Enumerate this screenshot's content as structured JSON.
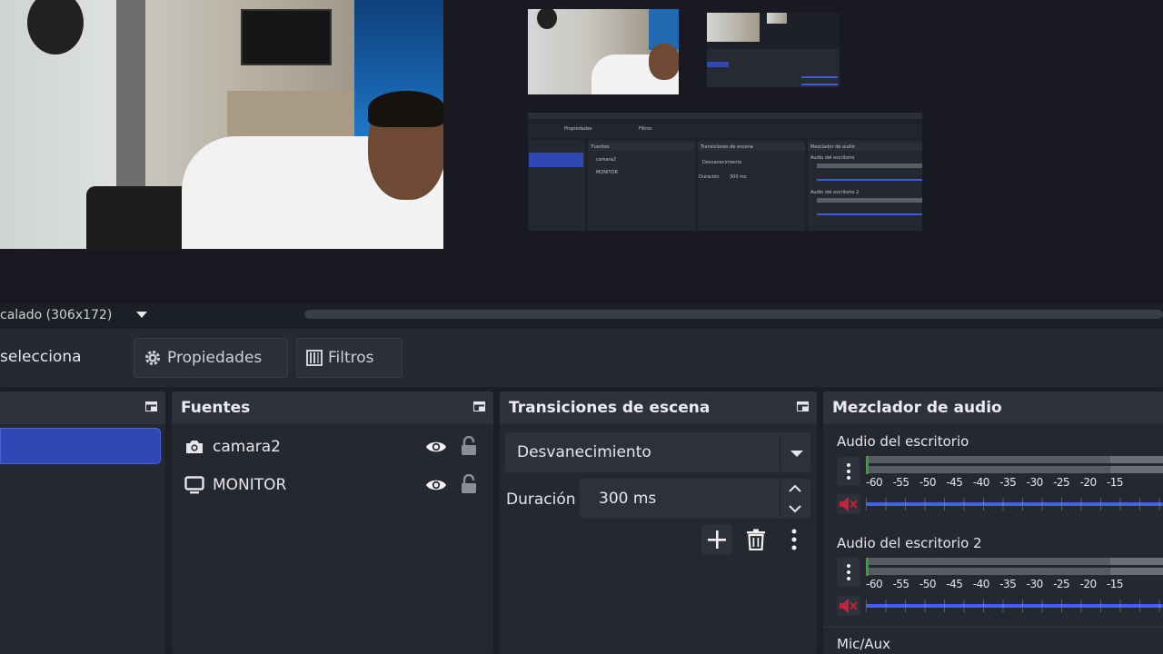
{
  "preview": {
    "minis": [
      "Desvanecimiento",
      "300 ms",
      "Fuentes",
      "camara2",
      "MONITOR",
      "Transiciones de escena",
      "Mezclador de audio",
      "Audio del escritorio",
      "Audio del escritorio 2",
      "Duración",
      "Propiedades",
      "Filtros"
    ]
  },
  "toolbar": {
    "scale_label": "calado (306x172)",
    "selected_label": "seleccionad",
    "properties_label": "Propiedades",
    "filters_label": "Filtros"
  },
  "sources": {
    "title": "Fuentes",
    "items": [
      {
        "label": "camara2",
        "icon": "camera-icon"
      },
      {
        "label": "MONITOR",
        "icon": "monitor-icon"
      }
    ]
  },
  "transitions": {
    "title": "Transiciones de escena",
    "selected": "Desvanecimiento",
    "duration_label": "Duración",
    "duration_value": "300 ms"
  },
  "mixer": {
    "title": "Mezclador de audio",
    "tracks": [
      {
        "name": "Audio del escritorio",
        "ticks": [
          "-60",
          "-55",
          "-50",
          "-45",
          "-40",
          "-35",
          "-30",
          "-25",
          "-20",
          "-15"
        ]
      },
      {
        "name": "Audio del escritorio 2",
        "ticks": [
          "-60",
          "-55",
          "-50",
          "-45",
          "-40",
          "-35",
          "-30",
          "-25",
          "-20",
          "-15"
        ]
      },
      {
        "name": "Mic/Aux"
      }
    ]
  },
  "colors": {
    "accent": "#2f48b5",
    "fader": "#4263e6",
    "muted": "#c0233a"
  }
}
